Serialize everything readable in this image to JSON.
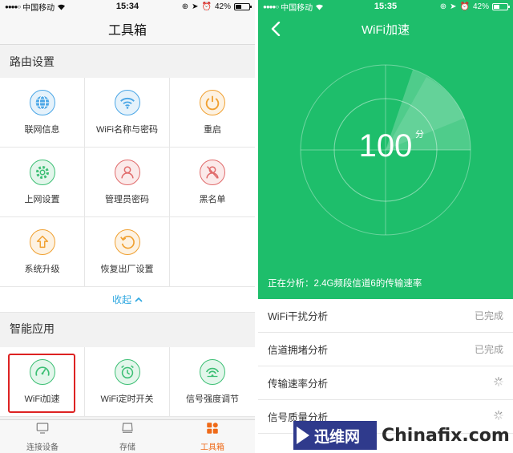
{
  "left": {
    "status": {
      "carrier": "中国移动",
      "time": "15:34",
      "battery": "42%"
    },
    "title": "工具箱",
    "router_section": "路由设置",
    "router_tools": [
      {
        "label": "联网信息",
        "icon": "globe-icon",
        "color": "#4aa6e6"
      },
      {
        "label": "WiFi名称与密码",
        "icon": "wifi-icon",
        "color": "#4aa6e6"
      },
      {
        "label": "重启",
        "icon": "power-icon",
        "color": "#f0a030"
      },
      {
        "label": "上网设置",
        "icon": "gear-icon",
        "color": "#3cbf74"
      },
      {
        "label": "管理员密码",
        "icon": "user-icon",
        "color": "#e06a6a"
      },
      {
        "label": "黑名单",
        "icon": "block-user-icon",
        "color": "#e06a6a"
      },
      {
        "label": "系统升级",
        "icon": "upgrade-icon",
        "color": "#f0a030"
      },
      {
        "label": "恢复出厂设置",
        "icon": "restore-icon",
        "color": "#f0a030"
      },
      {
        "label": "",
        "icon": "",
        "color": ""
      }
    ],
    "collapse_label": "收起",
    "smart_section": "智能应用",
    "smart_apps": [
      {
        "label": "WiFi加速",
        "icon": "speedometer-icon",
        "color": "#3cbf74"
      },
      {
        "label": "WiFi定时开关",
        "icon": "alarm-clock-icon",
        "color": "#3cbf74"
      },
      {
        "label": "信号强度调节",
        "icon": "signal-icon",
        "color": "#3cbf74"
      }
    ],
    "tabs": [
      {
        "label": "连接设备",
        "icon": "monitor-icon",
        "active": false
      },
      {
        "label": "存储",
        "icon": "storage-icon",
        "active": false
      },
      {
        "label": "工具箱",
        "icon": "toolbox-icon",
        "active": true
      }
    ]
  },
  "right": {
    "status": {
      "carrier": "中国移动",
      "time": "15:35",
      "battery": "42%"
    },
    "title": "WiFi加速",
    "score": "100",
    "score_unit": "分",
    "analyzing": "正在分析：2.4G频段信道6的传输速率",
    "checks": [
      {
        "label": "WiFi干扰分析",
        "status": "已完成",
        "done": true
      },
      {
        "label": "信道拥堵分析",
        "status": "已完成",
        "done": true
      },
      {
        "label": "传输速率分析",
        "status": "",
        "done": false
      },
      {
        "label": "信号质量分析",
        "status": "",
        "done": false
      }
    ]
  },
  "watermark": {
    "logo_text": "迅维网",
    "site": "Chinafix.com"
  },
  "colors": {
    "accent_green": "#1ebe6b",
    "accent_orange": "#ef6a18",
    "link_blue": "#2ea7e0"
  }
}
